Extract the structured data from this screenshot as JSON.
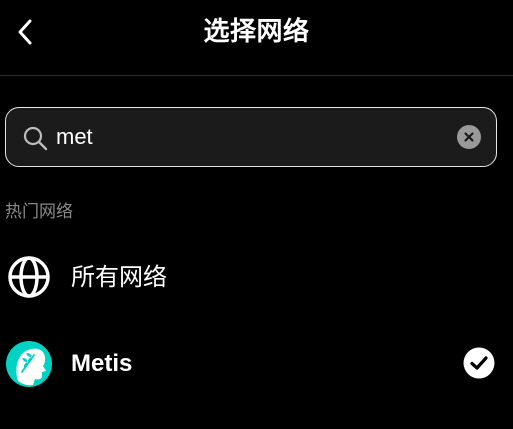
{
  "header": {
    "title": "选择网络",
    "back_icon": "chevron-left-icon"
  },
  "search": {
    "value": "met",
    "icon": "search-icon",
    "clear_icon": "clear-icon"
  },
  "section": {
    "label": "热门网络"
  },
  "networks": [
    {
      "label": "所有网络",
      "icon": "globe-icon",
      "selected": false
    },
    {
      "label": "Metis",
      "icon": "metis-logo-icon",
      "selected": true,
      "brand_color": "#00d2c3"
    }
  ],
  "colors": {
    "background": "#000000",
    "text": "#ffffff",
    "muted": "#8a8a8a",
    "accent": "#00d2c3"
  }
}
